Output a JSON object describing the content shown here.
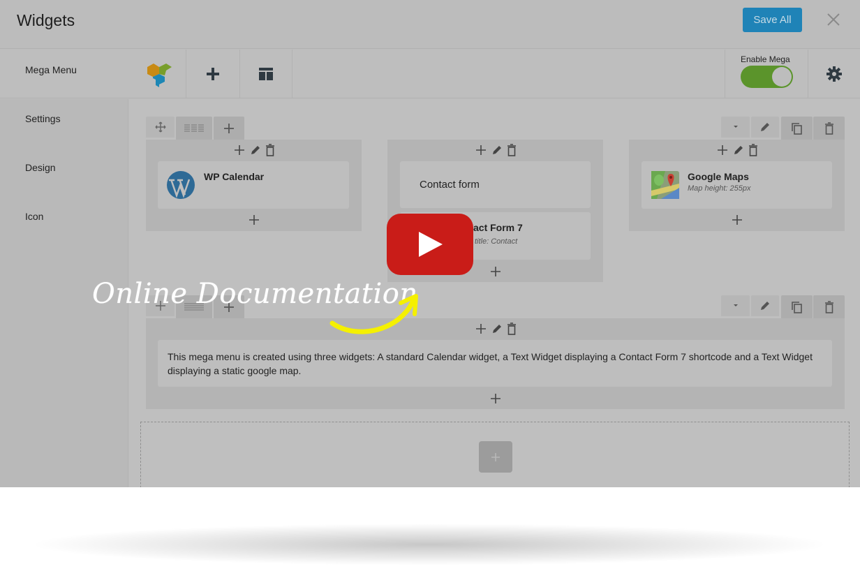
{
  "header": {
    "title": "Widgets",
    "save_label": "Save All",
    "close_icon": "close-icon"
  },
  "tabbar": {
    "active_tab": "Mega Menu",
    "tools": [
      "page-builder-logo-icon",
      "plus-icon",
      "layout-icon"
    ],
    "enable_label": "Enable Mega",
    "enable_mega": true,
    "settings_icon": "gear-icon"
  },
  "sidebar": {
    "items": [
      {
        "label": "Settings"
      },
      {
        "label": "Design"
      },
      {
        "label": "Icon"
      }
    ]
  },
  "rows": [
    {
      "row_tools": [
        "move-icon",
        "columns-icon",
        "plus-icon"
      ],
      "row_actions": [
        "caret-down-icon",
        "pencil-icon",
        "copy-icon",
        "trash-icon"
      ],
      "columns": [
        {
          "widgets": [
            {
              "title": "WP Calendar",
              "subtitle": "",
              "icon": "wordpress-icon"
            }
          ]
        },
        {
          "widgets": [
            {
              "title": "Contact form",
              "subtitle": ""
            },
            {
              "title": "Contact Form 7",
              "visible_title": "act Form 7",
              "subtitle": "title: Contact"
            }
          ]
        },
        {
          "widgets": [
            {
              "title": "Google Maps",
              "subtitle": "Map height: 255px",
              "icon": "google-maps-icon"
            }
          ]
        }
      ]
    },
    {
      "row_tools": [
        "move-icon",
        "columns-icon",
        "plus-icon"
      ],
      "row_actions": [
        "caret-down-icon",
        "pencil-icon",
        "copy-icon",
        "trash-icon"
      ],
      "columns": [
        {
          "widgets": [
            {
              "description": "This mega menu is created using three widgets: A standard Calendar widget, a Text Widget displaying a Contact Form 7 shortcode and a Text Widget displaying a static google map."
            }
          ]
        }
      ]
    }
  ],
  "overlay": {
    "doc_label": "Online Documentation",
    "video_icon": "youtube-play-icon",
    "colors": {
      "youtube": "#c91c18",
      "arrow": "#f5f000",
      "save": "#1f83b7",
      "toggle": "#5b942b"
    }
  }
}
